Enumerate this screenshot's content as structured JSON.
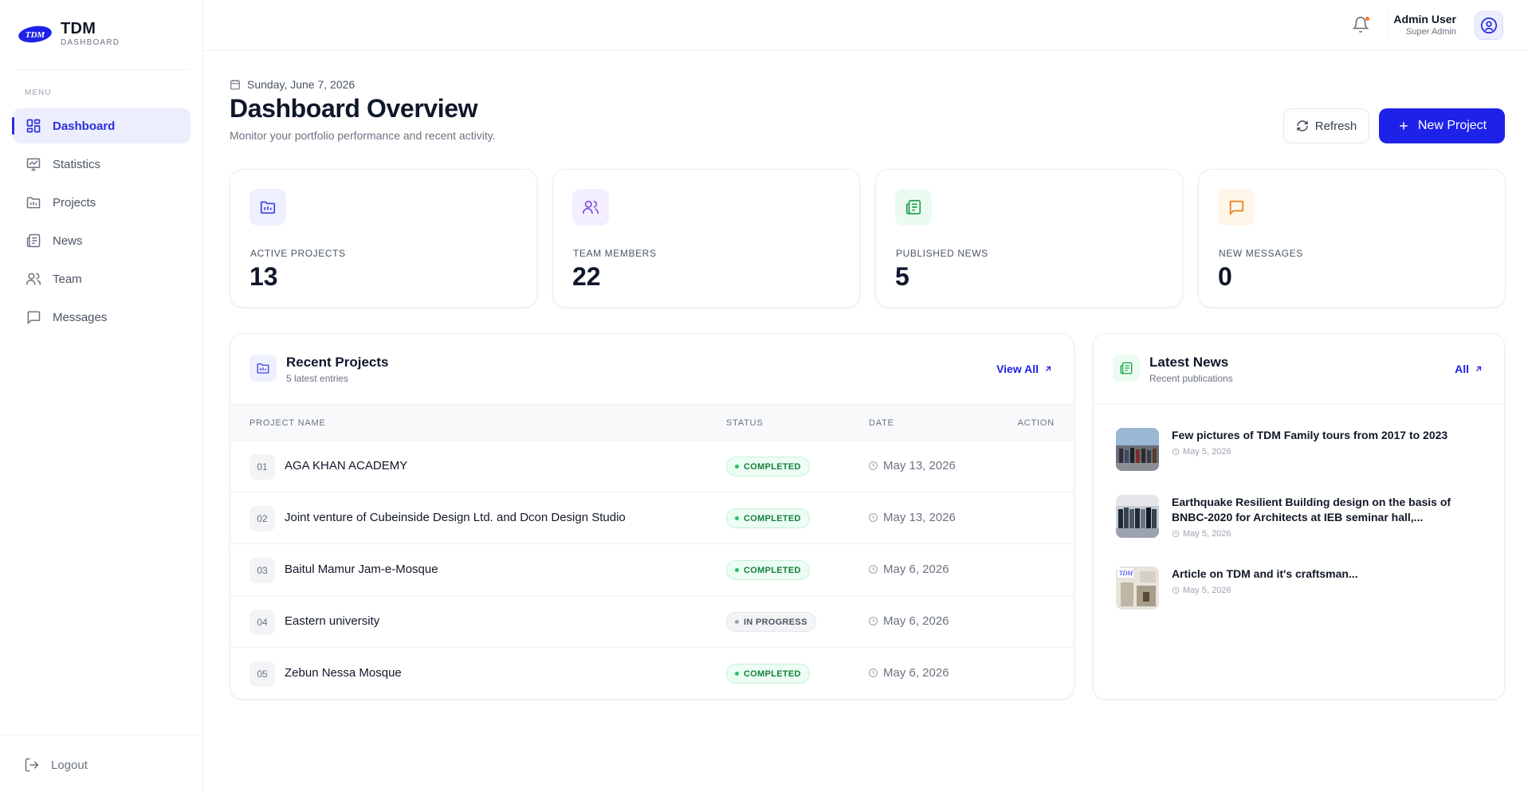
{
  "brand": {
    "logo_text": "TDM",
    "title": "TDM",
    "subtitle": "DASHBOARD"
  },
  "sidebar": {
    "menu_label": "MENU",
    "items": [
      {
        "label": "Dashboard",
        "icon": "dashboard-icon",
        "active": true
      },
      {
        "label": "Statistics",
        "icon": "statistics-icon",
        "active": false
      },
      {
        "label": "Projects",
        "icon": "projects-icon",
        "active": false
      },
      {
        "label": "News",
        "icon": "news-icon",
        "active": false
      },
      {
        "label": "Team",
        "icon": "team-icon",
        "active": false
      },
      {
        "label": "Messages",
        "icon": "messages-icon",
        "active": false
      }
    ],
    "logout_label": "Logout"
  },
  "topbar": {
    "user_name": "Admin User",
    "user_role": "Super Admin",
    "notification_icon": "bell-icon",
    "avatar_icon": "user-circle-icon"
  },
  "header": {
    "date": "Sunday, June 7, 2026",
    "title": "Dashboard Overview",
    "subtitle": "Monitor your portfolio performance and recent activity.",
    "refresh_label": "Refresh",
    "new_project_label": "New Project"
  },
  "stats": [
    {
      "label": "ACTIVE PROJECTS",
      "value": "13",
      "icon": "folder-icon",
      "color": "#3b3fe0",
      "bg": "#eef0ff"
    },
    {
      "label": "TEAM MEMBERS",
      "value": "22",
      "icon": "users-icon",
      "color": "#7c4de8",
      "bg": "#f3efff"
    },
    {
      "label": "PUBLISHED NEWS",
      "value": "5",
      "icon": "newspaper-icon",
      "color": "#16a34a",
      "bg": "#ecfbf1"
    },
    {
      "label": "NEW MESSAGES",
      "value": "0",
      "icon": "message-icon",
      "color": "#ea7a0c",
      "bg": "#fff6ea"
    }
  ],
  "recent_projects": {
    "title": "Recent Projects",
    "subtitle": "5 latest entries",
    "view_all_label": "View All",
    "columns": [
      "PROJECT NAME",
      "STATUS",
      "DATE",
      "ACTION"
    ],
    "rows": [
      {
        "num": "01",
        "name": "AGA KHAN ACADEMY",
        "status": "COMPLETED",
        "date": "May 13, 2026"
      },
      {
        "num": "02",
        "name": "Joint venture of Cubeinside Design Ltd. and Dcon Design Studio",
        "status": "COMPLETED",
        "date": "May 13, 2026"
      },
      {
        "num": "03",
        "name": "Baitul Mamur Jam-e-Mosque",
        "status": "COMPLETED",
        "date": "May 6, 2026"
      },
      {
        "num": "04",
        "name": "Eastern university",
        "status": "IN PROGRESS",
        "date": "May 6, 2026"
      },
      {
        "num": "05",
        "name": "Zebun Nessa Mosque",
        "status": "COMPLETED",
        "date": "May 6, 2026"
      }
    ]
  },
  "latest_news": {
    "title": "Latest News",
    "subtitle": "Recent publications",
    "all_label": "All",
    "items": [
      {
        "title": "Few pictures of TDM Family tours from 2017 to 2023",
        "date": "May 5, 2026"
      },
      {
        "title": "Earthquake Resilient Building design on the basis of BNBC-2020 for Architects at IEB seminar hall,...",
        "date": "May 5, 2026"
      },
      {
        "title": "Article on TDM and it's craftsman...",
        "date": "May 5, 2026"
      }
    ]
  }
}
